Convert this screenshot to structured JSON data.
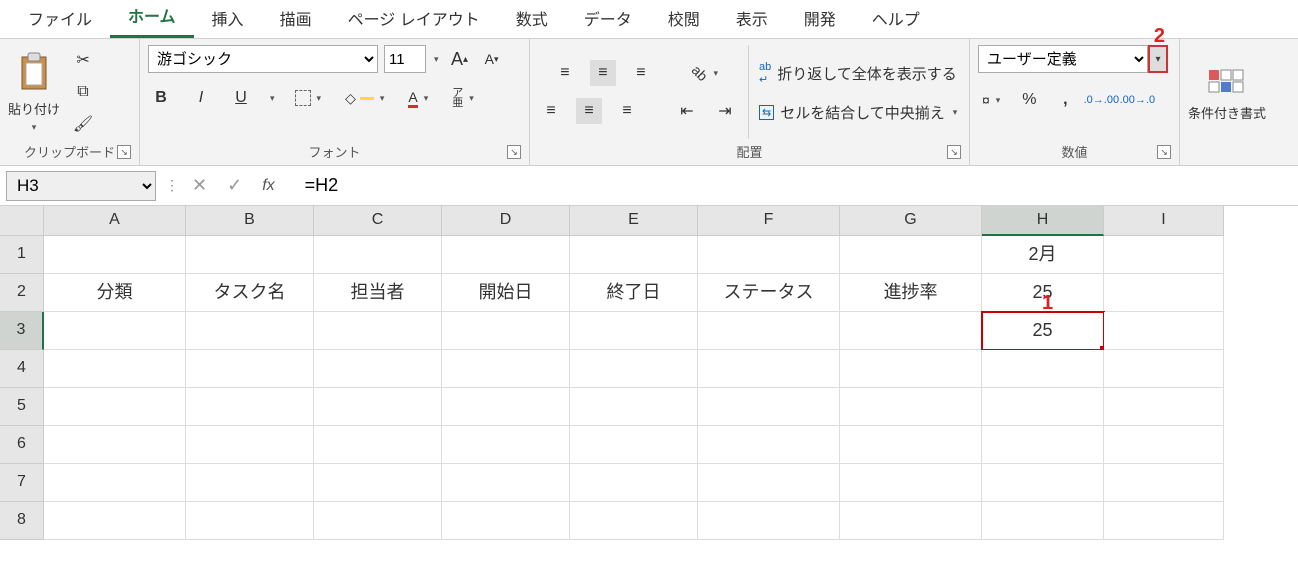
{
  "tabs": {
    "file": "ファイル",
    "home": "ホーム",
    "insert": "挿入",
    "draw": "描画",
    "layout": "ページ レイアウト",
    "formulas": "数式",
    "data": "データ",
    "review": "校閲",
    "view": "表示",
    "developer": "開発",
    "help": "ヘルプ"
  },
  "ribbon": {
    "clipboard": {
      "paste": "貼り付け",
      "label": "クリップボード"
    },
    "font": {
      "name": "游ゴシック",
      "size": "11",
      "label": "フォント"
    },
    "alignment": {
      "wrap": "折り返して全体を表示する",
      "merge": "セルを結合して中央揃え",
      "label": "配置"
    },
    "number": {
      "format": "ユーザー定義",
      "label": "数値"
    },
    "styles": {
      "cond": "条件付き書式",
      "label": ""
    }
  },
  "annotations": {
    "one": "1",
    "two": "2"
  },
  "namebox": "H3",
  "formula": "=H2",
  "columns": [
    "A",
    "B",
    "C",
    "D",
    "E",
    "F",
    "G",
    "H",
    "I"
  ],
  "rows": [
    "1",
    "2",
    "3",
    "4",
    "5",
    "6",
    "7",
    "8"
  ],
  "cells": {
    "H1": "2月",
    "A2": "分類",
    "B2": "タスク名",
    "C2": "担当者",
    "D2": "開始日",
    "E2": "終了日",
    "F2": "ステータス",
    "G2": "進捗率",
    "H2": "25",
    "H3": "25"
  },
  "selected": "H3"
}
